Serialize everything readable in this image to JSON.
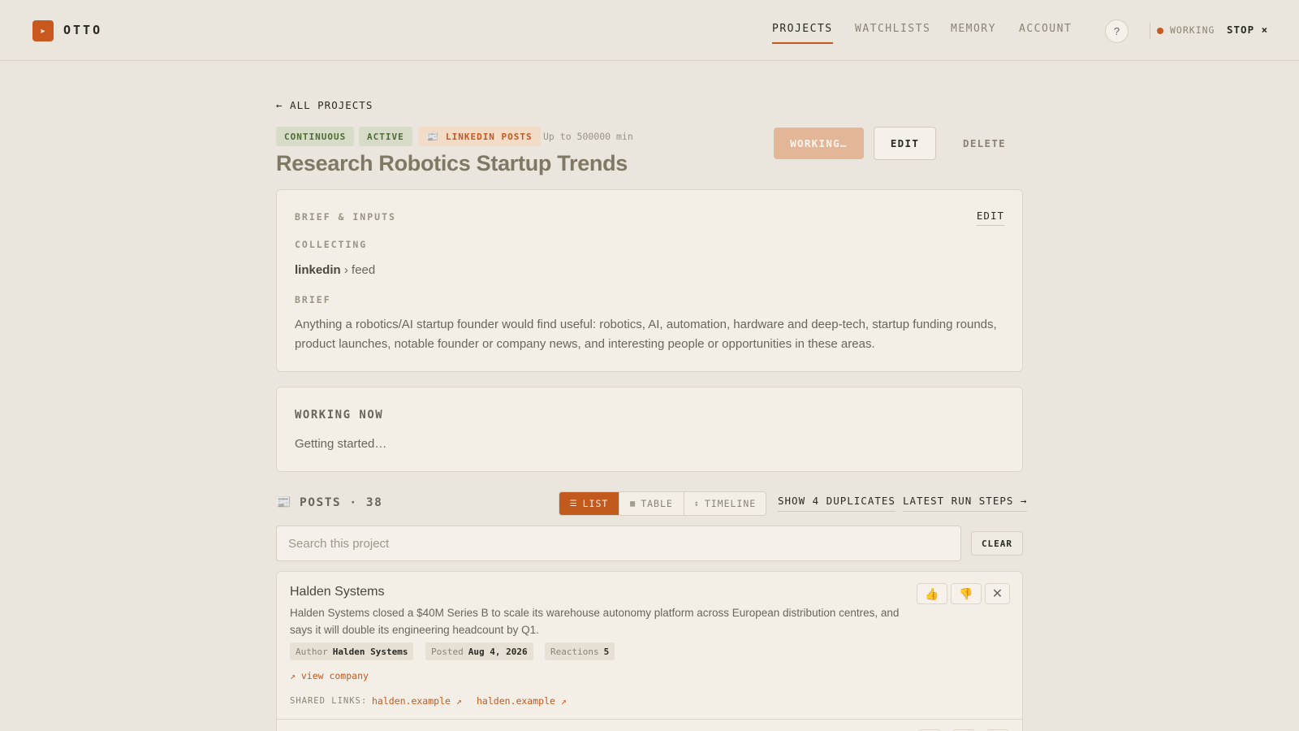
{
  "app": {
    "logo_glyph": "▸",
    "name": "OTTO"
  },
  "nav": {
    "items": [
      {
        "label": "PROJECTS",
        "active": true
      },
      {
        "label": "WATCHLISTS",
        "active": false
      },
      {
        "label": "MEMORY",
        "active": false
      },
      {
        "label": "ACCOUNT",
        "active": false
      }
    ],
    "help": "?",
    "status": "WORKING",
    "stop": "STOP ×"
  },
  "project": {
    "back": "← ALL PROJECTS",
    "tags": [
      "CONTINUOUS",
      "ACTIVE"
    ],
    "source_tag": {
      "icon": "📰",
      "label": "LINKEDIN POSTS"
    },
    "duration": "Up to 500000 min",
    "title": "Research Robotics Startup Trends",
    "actions": {
      "working": "WORKING…",
      "edit": "EDIT",
      "delete": "DELETE"
    }
  },
  "brief": {
    "heading": "BRIEF & INPUTS",
    "edit": "EDIT",
    "collecting_label": "COLLECTING",
    "source": "linkedin",
    "source_path": "› feed",
    "brief_label": "BRIEF",
    "text": "Anything a robotics/AI startup founder would find useful: robotics, AI, automation, hardware and deep-tech, startup funding rounds, product launches, notable founder or company news, and interesting people or opportunities in these areas."
  },
  "working": {
    "heading": "WORKING NOW",
    "text": "Getting started…"
  },
  "posts": {
    "icon": "📰",
    "title": "POSTS · 38",
    "views": [
      {
        "glyph": "☰",
        "label": "LIST",
        "active": true
      },
      {
        "glyph": "▦",
        "label": "TABLE",
        "active": false
      },
      {
        "glyph": "↕",
        "label": "TIMELINE",
        "active": false
      }
    ],
    "duplicates": "SHOW 4 DUPLICATES",
    "run_steps": "LATEST RUN STEPS →",
    "search_placeholder": "Search this project",
    "clear": "CLEAR",
    "items": [
      {
        "title": "Halden Systems",
        "body": "Halden Systems closed a $40M Series B to scale its warehouse autonomy platform across European distribution centres, and says it will double its engineering headcount by Q1.",
        "meta": [
          {
            "key": "Author",
            "value": "Halden Systems"
          },
          {
            "key": "Posted",
            "value": "Aug 4, 2026"
          },
          {
            "key": "Reactions",
            "value": "5"
          }
        ],
        "view_company": "↗ view company",
        "shared_label": "SHARED LINKS:",
        "shared_links": [
          "halden.example ↗",
          "halden.example ↗"
        ],
        "feedback": {
          "up": "👍",
          "down": "👎",
          "dismiss": "✕"
        }
      }
    ]
  },
  "colors": {
    "accent": "#c25a1e",
    "background": "#ebe6dd",
    "card": "#f3efe7"
  }
}
